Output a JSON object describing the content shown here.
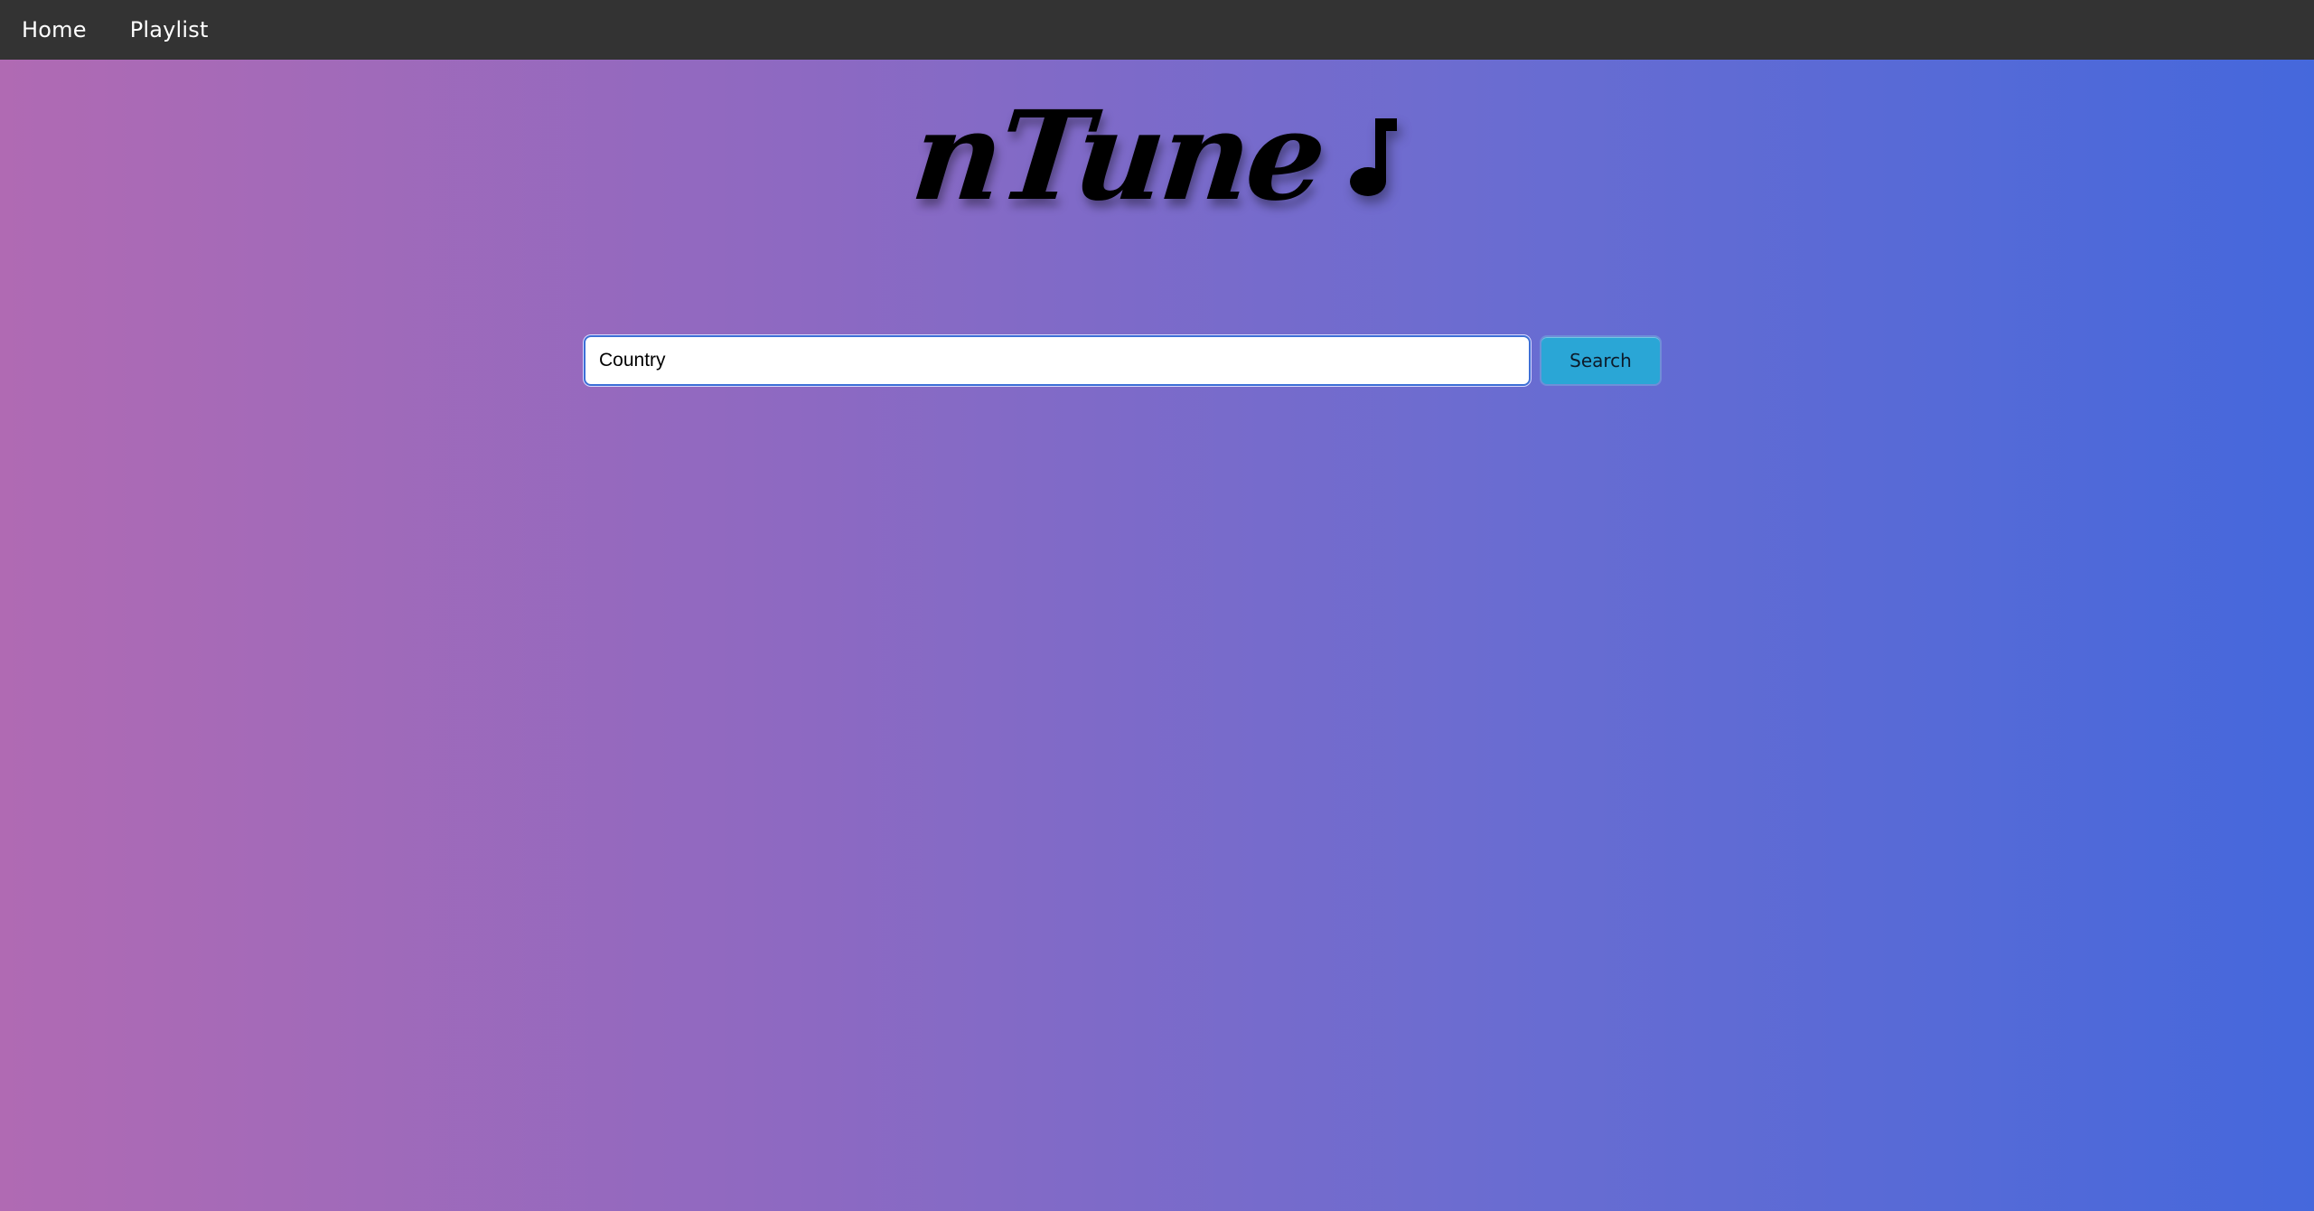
{
  "nav": {
    "items": [
      {
        "label": "Home"
      },
      {
        "label": "Playlist"
      }
    ]
  },
  "header": {
    "logo_text": "nTune",
    "logo_icon": "music-note-icon"
  },
  "search": {
    "value": "Country",
    "placeholder": "",
    "button_label": "Search"
  },
  "colors": {
    "navbar_bg": "#333333",
    "gradient_start": "#b06ab3",
    "gradient_end": "#4568dc",
    "search_button_bg": "#2aa6d6"
  }
}
